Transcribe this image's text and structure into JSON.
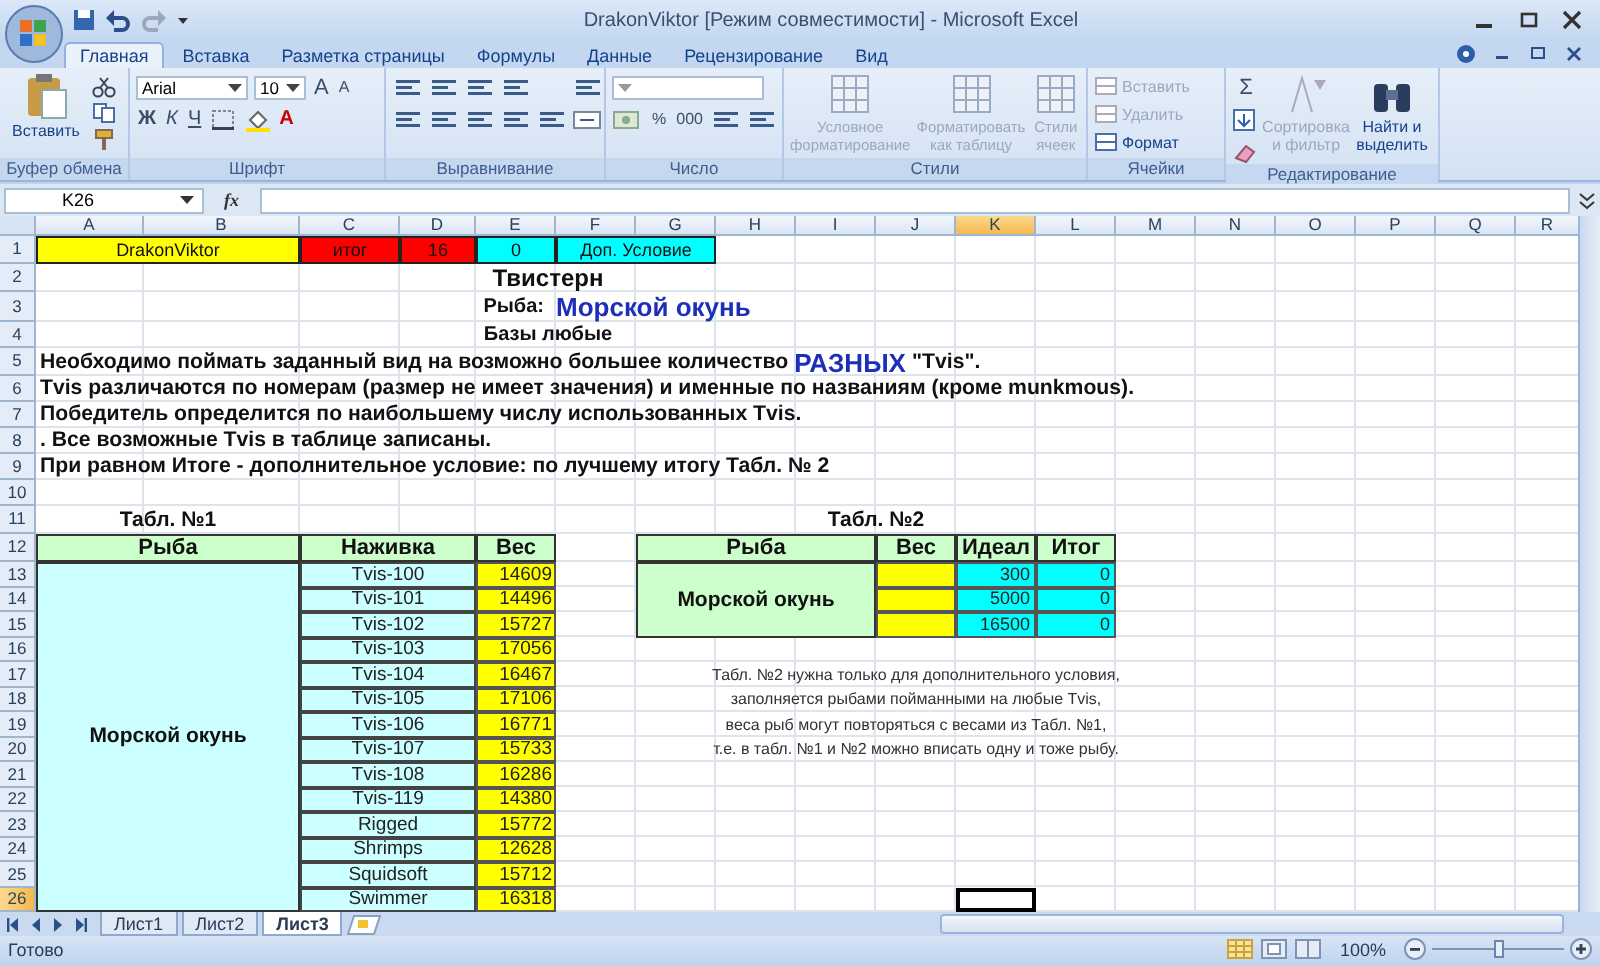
{
  "window": {
    "title": "DrakonViktor  [Режим совместимости] - Microsoft Excel"
  },
  "tabs": [
    {
      "label": "Главная",
      "selected": true
    },
    {
      "label": "Вставка",
      "selected": false
    },
    {
      "label": "Разметка страницы",
      "selected": false
    },
    {
      "label": "Формулы",
      "selected": false
    },
    {
      "label": "Данные",
      "selected": false
    },
    {
      "label": "Рецензирование",
      "selected": false
    },
    {
      "label": "Вид",
      "selected": false
    }
  ],
  "ribbon": {
    "groups": [
      {
        "kind": "clipboard",
        "label": "Буфер обмена",
        "paste": "Вставить"
      },
      {
        "kind": "font",
        "label": "Шрифт",
        "font": "Arial",
        "size": "10",
        "size_buttons": [
          "A",
          "A"
        ],
        "styles": [
          "Ж",
          "К",
          "Ч"
        ],
        "color_button": "A"
      },
      {
        "kind": "alignment",
        "label": "Выравнивание"
      },
      {
        "kind": "number",
        "label": "Число",
        "buttons": [
          "%",
          "000"
        ]
      },
      {
        "kind": "styles",
        "label": "Стили",
        "commands": [
          {
            "label": "Условное форматирование",
            "disabled": true
          },
          {
            "label": "Форматировать как таблицу",
            "disabled": true
          },
          {
            "label": "Стили ячеек",
            "disabled": true
          }
        ]
      },
      {
        "kind": "cells",
        "label": "Ячейки",
        "commands": [
          {
            "label": "Вставить",
            "disabled": true
          },
          {
            "label": "Удалить",
            "disabled": true
          },
          {
            "label": "Формат",
            "disabled": false
          }
        ]
      },
      {
        "kind": "editing",
        "label": "Редактирование",
        "sum": "Σ",
        "commands": [
          {
            "label": "Сортировка и фильтр",
            "disabled": true
          },
          {
            "label": "Найти и выделить",
            "disabled": false
          }
        ]
      }
    ]
  },
  "formula_bar": {
    "name_box": "K26",
    "fx": "fx"
  },
  "sheet": {
    "columns": [
      {
        "label": "A",
        "selected": false
      },
      {
        "label": "B",
        "selected": false
      },
      {
        "label": "C",
        "selected": false
      },
      {
        "label": "D",
        "selected": false
      },
      {
        "label": "E",
        "selected": false
      },
      {
        "label": "F",
        "selected": false
      },
      {
        "label": "G",
        "selected": false
      },
      {
        "label": "H",
        "selected": false
      },
      {
        "label": "I",
        "selected": false
      },
      {
        "label": "J",
        "selected": false
      },
      {
        "label": "K",
        "selected": true
      },
      {
        "label": "L",
        "selected": false
      },
      {
        "label": "M",
        "selected": false
      },
      {
        "label": "N",
        "selected": false
      },
      {
        "label": "O",
        "selected": false
      },
      {
        "label": "P",
        "selected": false
      },
      {
        "label": "Q",
        "selected": false
      },
      {
        "label": "R",
        "selected": false
      }
    ],
    "rows": [
      {
        "label": "1",
        "selected": false
      },
      {
        "label": "2",
        "selected": false
      },
      {
        "label": "3",
        "selected": false
      },
      {
        "label": "4",
        "selected": false
      },
      {
        "label": "5",
        "selected": false
      },
      {
        "label": "6",
        "selected": false
      },
      {
        "label": "7",
        "selected": false
      },
      {
        "label": "8",
        "selected": false
      },
      {
        "label": "9",
        "selected": false
      },
      {
        "label": "10",
        "selected": false
      },
      {
        "label": "11",
        "selected": false
      },
      {
        "label": "12",
        "selected": false
      },
      {
        "label": "13",
        "selected": false
      },
      {
        "label": "14",
        "selected": false
      },
      {
        "label": "15",
        "selected": false
      },
      {
        "label": "16",
        "selected": false
      },
      {
        "label": "17",
        "selected": false
      },
      {
        "label": "18",
        "selected": false
      },
      {
        "label": "19",
        "selected": false
      },
      {
        "label": "20",
        "selected": false
      },
      {
        "label": "21",
        "selected": false
      },
      {
        "label": "22",
        "selected": false
      },
      {
        "label": "23",
        "selected": false
      },
      {
        "label": "24",
        "selected": false
      },
      {
        "label": "25",
        "selected": false
      },
      {
        "label": "26",
        "selected": true
      }
    ],
    "header_cells": [
      {
        "text": "DrakonViktor",
        "color": "#ffff00"
      },
      {
        "text": "итог",
        "color": "#ff0000"
      },
      {
        "text": "16",
        "color": "#ff0000"
      },
      {
        "text": "0",
        "color": "#00ffff"
      },
      {
        "text": "Доп. Условие",
        "color": "#00ffff"
      }
    ],
    "title": "Твистерн",
    "fish_label": "Рыба:",
    "fish": "Морской окунь",
    "bases": "Базы любые",
    "rules": [
      {
        "text": "Необходимо поймать заданный вид на возможно большее количество",
        "highlight": "РАЗНЫХ",
        "tail": "\"Tvis\"."
      },
      {
        "text": "Tvis различаются по номерам (размер не имеет значения) и именные по названиям (кроме munkmous)."
      },
      {
        "text": "Победитель определится по наибольшему числу использованных Tvis."
      },
      {
        "text": ". Все возможные Tvis в таблице записаны."
      },
      {
        "text": "При равном Итоге - дополнительное условие: по лучшему итогу Табл. № 2"
      }
    ],
    "table1": {
      "title": "Табл. №1",
      "columns": [
        "Рыба",
        "Наживка",
        "Вес"
      ],
      "fish": "Морской окунь",
      "rows": [
        {
          "bait": "Tvis-100",
          "weight": "14609"
        },
        {
          "bait": "Tvis-101",
          "weight": "14496"
        },
        {
          "bait": "Tvis-102",
          "weight": "15727"
        },
        {
          "bait": "Tvis-103",
          "weight": "17056"
        },
        {
          "bait": "Tvis-104",
          "weight": "16467"
        },
        {
          "bait": "Tvis-105",
          "weight": "17106"
        },
        {
          "bait": "Tvis-106",
          "weight": "16771"
        },
        {
          "bait": "Tvis-107",
          "weight": "15733"
        },
        {
          "bait": "Tvis-108",
          "weight": "16286"
        },
        {
          "bait": "Tvis-119",
          "weight": "14380"
        },
        {
          "bait": "Rigged",
          "weight": "15772"
        },
        {
          "bait": "Shrimps",
          "weight": "12628"
        },
        {
          "bait": "Squidsoft",
          "weight": "15712"
        },
        {
          "bait": "Swimmer",
          "weight": "16318"
        }
      ]
    },
    "table2": {
      "title": "Табл. №2",
      "columns": [
        "Рыба",
        "Вес",
        "Идеал",
        "Итог"
      ],
      "fish": "Морской окунь",
      "rows": [
        {
          "ideal": "300",
          "total": "0"
        },
        {
          "ideal": "5000",
          "total": "0"
        },
        {
          "ideal": "16500",
          "total": "0"
        }
      ]
    },
    "note": [
      "Табл. №2 нужна только для дополнительного условия,",
      "заполняется рыбами пойманными на любые Tvis,",
      "веса рыб могут повторяться с весами из Табл. №1,",
      "т.е. в табл. №1 и №2 можно вписать одну и тоже рыбу."
    ]
  },
  "sheet_tabs": [
    {
      "label": "Лист1",
      "selected": false
    },
    {
      "label": "Лист2",
      "selected": false
    },
    {
      "label": "Лист3",
      "selected": true
    }
  ],
  "status_bar": {
    "text": "Готово",
    "zoom": "100%",
    "zoom_slider": {
      "level": 0.5
    }
  }
}
